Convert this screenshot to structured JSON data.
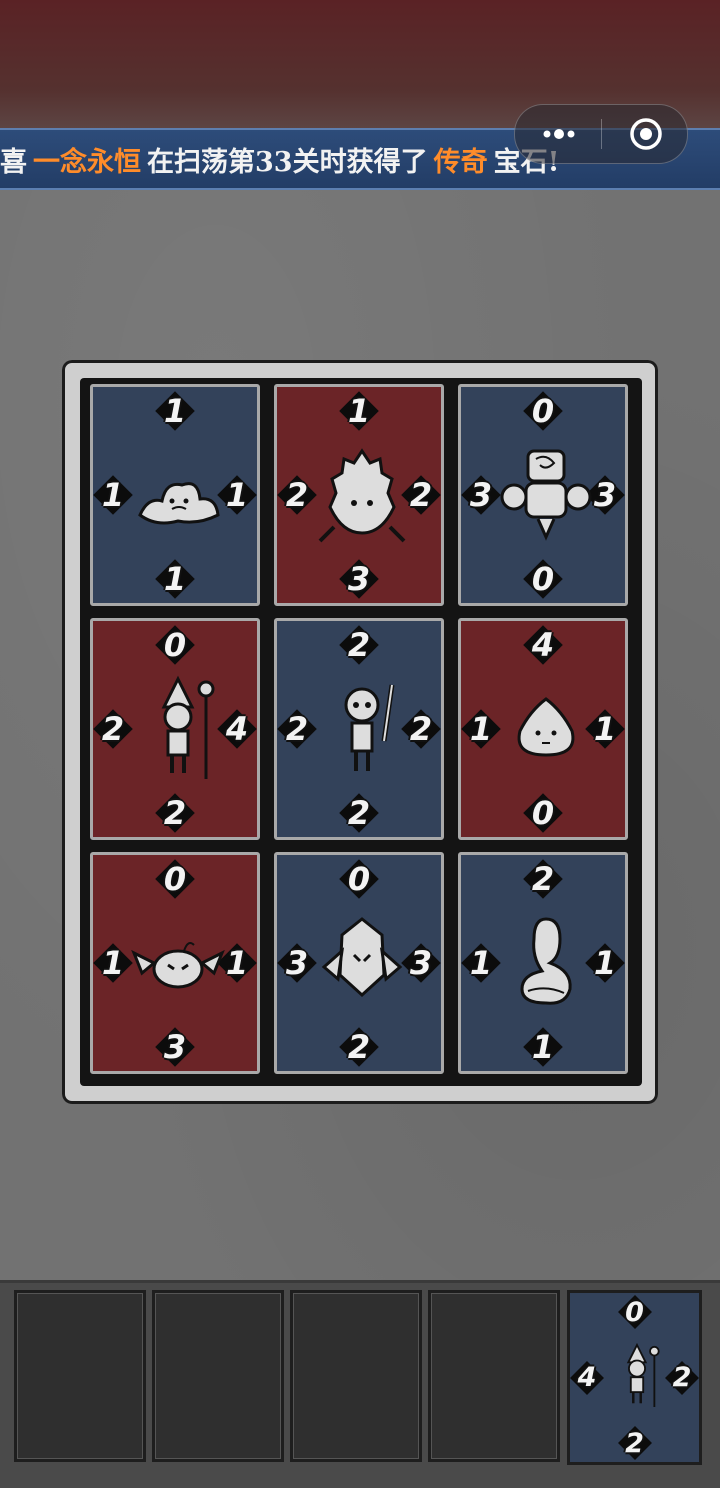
{
  "banner": {
    "parts": [
      "喜",
      "一念永恒",
      "在扫荡第33关时获得了",
      "传奇",
      "宝石!"
    ]
  },
  "capsule": {
    "left_icon": "more-dots-icon",
    "right_icon": "close-target-icon"
  },
  "board": {
    "cells": [
      {
        "color": "blue",
        "top": "1",
        "left": "1",
        "right": "1",
        "bottom": "1",
        "monster": "slime-puddle-icon"
      },
      {
        "color": "red",
        "top": "1",
        "left": "2",
        "right": "2",
        "bottom": "3",
        "monster": "spiky-egg-icon"
      },
      {
        "color": "blue",
        "top": "0",
        "left": "3",
        "right": "3",
        "bottom": "0",
        "monster": "stone-golem-icon"
      },
      {
        "color": "red",
        "top": "0",
        "left": "2",
        "right": "4",
        "bottom": "2",
        "monster": "skeleton-mage-icon"
      },
      {
        "color": "blue",
        "top": "2",
        "left": "2",
        "right": "2",
        "bottom": "2",
        "monster": "skeleton-sword-icon"
      },
      {
        "color": "red",
        "top": "4",
        "left": "1",
        "right": "1",
        "bottom": "0",
        "monster": "blob-icon"
      },
      {
        "color": "red",
        "top": "0",
        "left": "1",
        "right": "1",
        "bottom": "3",
        "monster": "winged-ball-icon"
      },
      {
        "color": "blue",
        "top": "0",
        "left": "3",
        "right": "3",
        "bottom": "2",
        "monster": "crystal-golem-icon"
      },
      {
        "color": "blue",
        "top": "2",
        "left": "1",
        "right": "1",
        "bottom": "1",
        "monster": "snake-worm-icon"
      }
    ]
  },
  "hand": {
    "empty_slots": 4,
    "card": {
      "color": "blue",
      "top": "0",
      "left": "4",
      "right": "2",
      "bottom": "2",
      "monster": "skeleton-mage-icon"
    }
  }
}
